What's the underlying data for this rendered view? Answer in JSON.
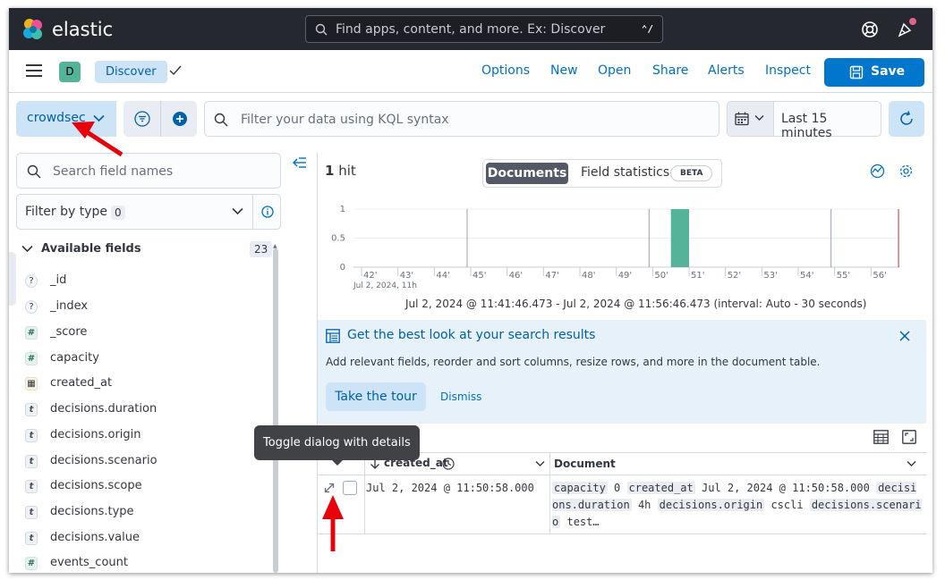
{
  "topbar": {
    "brand": "elastic",
    "search_placeholder": "Find apps, content, and more. Ex: Discover",
    "search_shortcut": "⌃/"
  },
  "appbar": {
    "space_initial": "D",
    "breadcrumb": "Discover",
    "links": [
      "Options",
      "New",
      "Open",
      "Share",
      "Alerts",
      "Inspect"
    ],
    "save_label": "Save"
  },
  "querybar": {
    "data_view": "crowdsec",
    "kql_placeholder": "Filter your data using KQL syntax",
    "time_range": "Last 15 minutes"
  },
  "sidebar": {
    "search_placeholder": "Search field names",
    "filter_by_type_label": "Filter by type",
    "filter_by_type_count": "0",
    "available_label": "Available fields",
    "available_count": "23",
    "fields": [
      {
        "name": "_id",
        "type": "unknown"
      },
      {
        "name": "_index",
        "type": "unknown"
      },
      {
        "name": "_score",
        "type": "number"
      },
      {
        "name": "capacity",
        "type": "number"
      },
      {
        "name": "created_at",
        "type": "date"
      },
      {
        "name": "decisions.duration",
        "type": "string"
      },
      {
        "name": "decisions.origin",
        "type": "string"
      },
      {
        "name": "decisions.scenario",
        "type": "string"
      },
      {
        "name": "decisions.scope",
        "type": "string"
      },
      {
        "name": "decisions.type",
        "type": "string"
      },
      {
        "name": "decisions.value",
        "type": "string"
      },
      {
        "name": "events_count",
        "type": "number"
      }
    ]
  },
  "main": {
    "hits_count": "1",
    "hits_label": "hit",
    "tab_documents": "Documents",
    "tab_field_statistics": "Field statistics",
    "beta_badge": "BETA",
    "chart_footer": "Jul 2, 2024 @ 11:41:46.473 - Jul 2, 2024 @ 11:56:46.473 (interval: Auto - 30 seconds)",
    "callout": {
      "title": "Get the best look at your search results",
      "text": "Add relevant fields, reorder and sort columns, resize rows, and more in the document table.",
      "tour_button": "Take the tour",
      "dismiss": "Dismiss"
    },
    "grid": {
      "col_created_at": "created_at",
      "col_document": "Document",
      "rows": [
        {
          "created_at": "Jul 2, 2024 @ 11:50:58.000",
          "doc": [
            {
              "k": "capacity",
              "v": "0"
            },
            {
              "k": "created_at",
              "v": "Jul 2, 2024 @ 11:50:58.000"
            },
            {
              "k": "decisions.duration",
              "v": "4h"
            },
            {
              "k": "decisions.origin",
              "v": "cscli"
            },
            {
              "k": "decisions.scenario",
              "v": "test…"
            }
          ]
        }
      ]
    },
    "tooltip": "Toggle dialog with details"
  },
  "colors": {
    "header_bg": "#25282f",
    "link": "#0071c2",
    "primary": "#0077cc",
    "bar": "#54b399",
    "annotation_arrow": "#e8000b"
  },
  "chart_data": {
    "type": "bar",
    "y_ticks": [
      "1",
      "0.5",
      "0"
    ],
    "ylim": [
      0,
      1
    ],
    "x_ticks": [
      "42'",
      "43'",
      "44'",
      "45'",
      "46'",
      "47'",
      "48'",
      "49'",
      "50'",
      "51'",
      "52'",
      "53'",
      "54'",
      "55'",
      "56'"
    ],
    "x_sublabel": "Jul 2, 2024, 11h",
    "xlim_minutes": [
      41.7779,
      56.7779
    ],
    "bars": [
      {
        "x_minutes": 50.5,
        "width_minutes": 0.5,
        "value": 1
      }
    ],
    "markers_minutes": [
      44.9,
      49.9,
      54.9
    ],
    "now_marker_minutes": 56.78,
    "grid": true,
    "legend": "none"
  }
}
